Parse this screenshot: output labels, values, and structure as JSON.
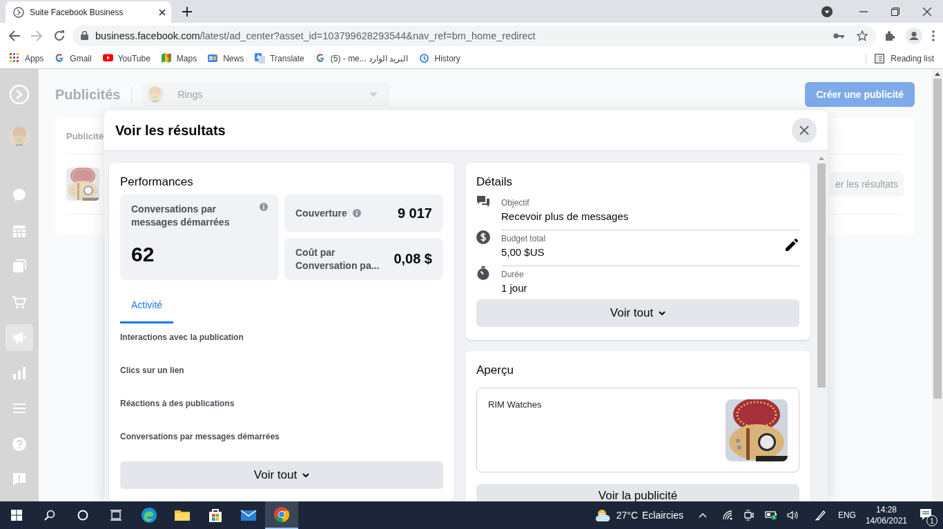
{
  "browser": {
    "tab_title": "Suite Facebook Business",
    "url_host": "business.facebook.com",
    "url_path": "/latest/ad_center?asset_id=103799628293544&nav_ref=bm_home_redirect",
    "bookmarks": [
      {
        "kind": "apps",
        "label": "Apps"
      },
      {
        "kind": "google",
        "label": "Gmail"
      },
      {
        "kind": "youtube",
        "label": "YouTube"
      },
      {
        "kind": "maps",
        "label": "Maps"
      },
      {
        "kind": "news",
        "label": "News"
      },
      {
        "kind": "translate",
        "label": "Translate"
      },
      {
        "kind": "google",
        "label": "(5) - me... البريد الوارد"
      },
      {
        "kind": "history",
        "label": "History"
      }
    ],
    "reading_list": "Reading list"
  },
  "sidebar": {
    "items": [
      {
        "kind": "chat",
        "selected": false
      },
      {
        "kind": "calendar",
        "selected": false
      },
      {
        "kind": "pages",
        "selected": false
      },
      {
        "kind": "cart",
        "selected": false
      },
      {
        "kind": "megaphone",
        "selected": true
      },
      {
        "kind": "chart",
        "selected": false
      },
      {
        "kind": "menu",
        "selected": false
      },
      {
        "kind": "help",
        "selected": false
      },
      {
        "kind": "feedback",
        "selected": false
      }
    ]
  },
  "background": {
    "title": "Publicités",
    "account": "Rings",
    "create_button": "Créer une publicité",
    "column_1": "Publicité",
    "row_button": "er les résultats"
  },
  "modal": {
    "title": "Voir les résultats",
    "performance": {
      "title": "Performances",
      "metrics": [
        {
          "label": "Conversations par messages démarrées",
          "value": "62",
          "info": true
        },
        {
          "label": "Couverture",
          "value": "9 017",
          "info": true
        },
        {
          "label": "Coût par Conversation pa...",
          "value": "0,08 $",
          "info": false
        }
      ],
      "tabs": [
        {
          "label": "Activité",
          "selected": true
        }
      ],
      "activity": [
        "Interactions avec la publication",
        "Clics sur un lien",
        "Réactions à des publications",
        "Conversations par messages démarrées"
      ],
      "button": "Voir tout"
    },
    "details": {
      "title": "Détails",
      "rows": [
        {
          "kind": "objective",
          "label": "Objectif",
          "value": "Recevoir plus de messages",
          "editable": false
        },
        {
          "kind": "budget",
          "label": "Budget total",
          "value": "5,00 $US",
          "editable": true
        },
        {
          "kind": "duration",
          "label": "Durée",
          "value": "1 jour",
          "editable": false
        }
      ],
      "button": "Voir tout"
    },
    "preview": {
      "title": "Aperçu",
      "page_name": "RIM Watches",
      "button": "Voir la publicité"
    }
  },
  "taskbar": {
    "apps": [
      {
        "kind": "edge",
        "active": false
      },
      {
        "kind": "explorer",
        "active": false
      },
      {
        "kind": "store",
        "active": false
      },
      {
        "kind": "mail",
        "active": false
      },
      {
        "kind": "chrome",
        "active": true
      }
    ],
    "temperature": "27°C",
    "weather": "Eclaircies",
    "language": "ENG",
    "time": "14:28",
    "date": "14/06/2021",
    "notifications": "1"
  }
}
